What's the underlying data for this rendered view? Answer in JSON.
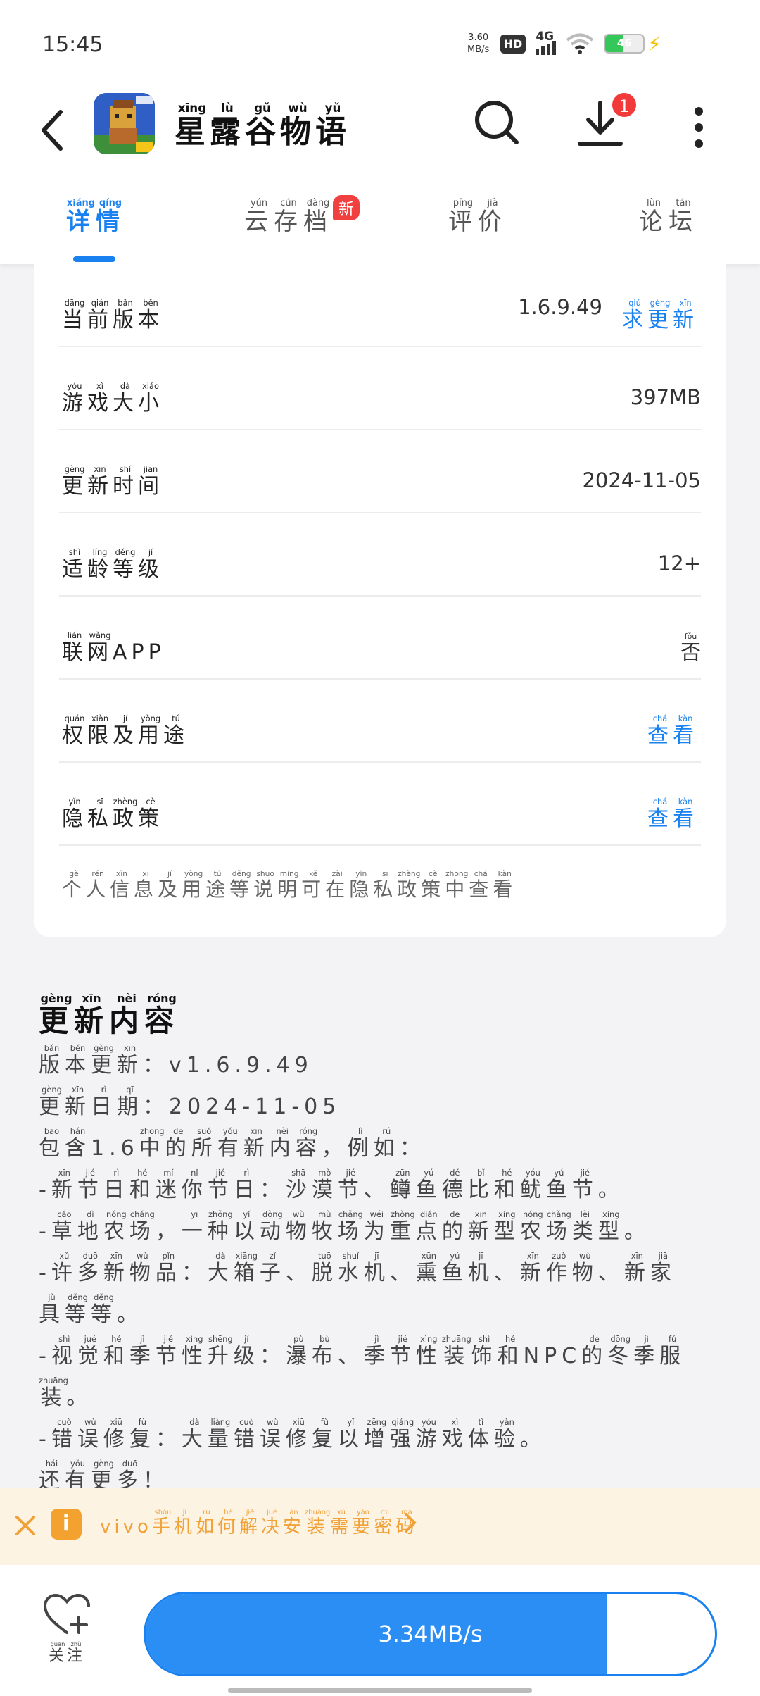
{
  "status_bar": {
    "time": "15:45",
    "net_speed_value": "3.60",
    "net_speed_unit": "MB/s",
    "hd": "HD",
    "network": "4G",
    "battery_level": "46",
    "battery_color": "#35c759"
  },
  "header": {
    "app_title": [
      {
        "char": "星",
        "py": "xīng"
      },
      {
        "char": "露",
        "py": "lù"
      },
      {
        "char": "谷",
        "py": "gǔ"
      },
      {
        "char": "物",
        "py": "wù"
      },
      {
        "char": "语",
        "py": "yǔ"
      }
    ],
    "download_badge": "1",
    "accent_color": "#1a82f0"
  },
  "tabs": {
    "details": [
      {
        "char": "详",
        "py": "xiáng"
      },
      {
        "char": "情",
        "py": "qíng"
      }
    ],
    "cloud_save": [
      {
        "char": "云",
        "py": "yún"
      },
      {
        "char": "存",
        "py": "cún"
      },
      {
        "char": "档",
        "py": "dàng"
      }
    ],
    "cloud_save_badge": "新",
    "reviews": [
      {
        "char": "评",
        "py": "píng"
      },
      {
        "char": "价",
        "py": "jià"
      }
    ],
    "forum": [
      {
        "char": "论",
        "py": "lùn"
      },
      {
        "char": "坛",
        "py": "tán"
      }
    ]
  },
  "info": {
    "current_version_label": [
      {
        "char": "当",
        "py": "dāng"
      },
      {
        "char": "前",
        "py": "qián"
      },
      {
        "char": "版",
        "py": "bǎn"
      },
      {
        "char": "本",
        "py": "běn"
      }
    ],
    "current_version_value": "1.6.9.49",
    "request_update": [
      {
        "char": "求",
        "py": "qiú"
      },
      {
        "char": "更",
        "py": "gèng"
      },
      {
        "char": "新",
        "py": "xīn"
      }
    ],
    "size_label": [
      {
        "char": "游",
        "py": "yóu"
      },
      {
        "char": "戏",
        "py": "xì"
      },
      {
        "char": "大",
        "py": "dà"
      },
      {
        "char": "小",
        "py": "xiǎo"
      }
    ],
    "size_value": "397MB",
    "update_time_label": [
      {
        "char": "更",
        "py": "gèng"
      },
      {
        "char": "新",
        "py": "xīn"
      },
      {
        "char": "时",
        "py": "shí"
      },
      {
        "char": "间",
        "py": "jiān"
      }
    ],
    "update_time_value": "2024-11-05",
    "age_label": [
      {
        "char": "适",
        "py": "shì"
      },
      {
        "char": "龄",
        "py": "líng"
      },
      {
        "char": "等",
        "py": "děng"
      },
      {
        "char": "级",
        "py": "jí"
      }
    ],
    "age_value": "12+",
    "online_label": [
      {
        "char": "联",
        "py": "lián"
      },
      {
        "char": "网",
        "py": "wǎng"
      },
      {
        "char": "APP",
        "py": ""
      }
    ],
    "online_value": [
      {
        "char": "否",
        "py": "fǒu"
      }
    ],
    "permissions_label": [
      {
        "char": "权",
        "py": "quán"
      },
      {
        "char": "限",
        "py": "xiàn"
      },
      {
        "char": "及",
        "py": "jí"
      },
      {
        "char": "用",
        "py": "yòng"
      },
      {
        "char": "途",
        "py": "tú"
      }
    ],
    "privacy_label": [
      {
        "char": "隐",
        "py": "yǐn"
      },
      {
        "char": "私",
        "py": "sī"
      },
      {
        "char": "政",
        "py": "zhèng"
      },
      {
        "char": "策",
        "py": "cè"
      }
    ],
    "view_link": [
      {
        "char": "查",
        "py": "chá"
      },
      {
        "char": "看",
        "py": "kàn"
      }
    ],
    "privacy_note": [
      {
        "char": "个",
        "py": "gè"
      },
      {
        "char": "人",
        "py": "rén"
      },
      {
        "char": "信",
        "py": "xìn"
      },
      {
        "char": "息",
        "py": "xī"
      },
      {
        "char": "及",
        "py": "jí"
      },
      {
        "char": "用",
        "py": "yòng"
      },
      {
        "char": "途",
        "py": "tú"
      },
      {
        "char": "等",
        "py": "děng"
      },
      {
        "char": "说",
        "py": "shuō"
      },
      {
        "char": "明",
        "py": "míng"
      },
      {
        "char": "可",
        "py": "kě"
      },
      {
        "char": "在",
        "py": "zài"
      },
      {
        "char": "隐",
        "py": "yǐn"
      },
      {
        "char": "私",
        "py": "sī"
      },
      {
        "char": "政",
        "py": "zhèng"
      },
      {
        "char": "策",
        "py": "cè"
      },
      {
        "char": "中",
        "py": "zhōng"
      },
      {
        "char": "查",
        "py": "chá"
      },
      {
        "char": "看",
        "py": "kàn"
      }
    ]
  },
  "update": {
    "title": [
      {
        "char": "更",
        "py": "gèng"
      },
      {
        "char": "新",
        "py": "xīn"
      },
      {
        "char": "内",
        "py": "nèi"
      },
      {
        "char": "容",
        "py": "róng"
      }
    ],
    "lines": [
      [
        {
          "char": "版",
          "py": "bǎn"
        },
        {
          "char": "本",
          "py": "běn"
        },
        {
          "char": "更",
          "py": "gèng"
        },
        {
          "char": "新",
          "py": "xīn"
        },
        {
          "char": "：",
          "py": ""
        },
        {
          "char": "v1.6.9.49",
          "py": ""
        }
      ],
      [
        {
          "char": "更",
          "py": "gèng"
        },
        {
          "char": "新",
          "py": "xīn"
        },
        {
          "char": "日",
          "py": "rì"
        },
        {
          "char": "期",
          "py": "qī"
        },
        {
          "char": "：",
          "py": ""
        },
        {
          "char": "2024-11-05",
          "py": ""
        }
      ],
      [
        {
          "char": "包",
          "py": "bāo"
        },
        {
          "char": "含",
          "py": "hán"
        },
        {
          "char": "1.6",
          "py": ""
        },
        {
          "char": "中",
          "py": "zhōng"
        },
        {
          "char": "的",
          "py": "de"
        },
        {
          "char": "所",
          "py": "suǒ"
        },
        {
          "char": "有",
          "py": "yǒu"
        },
        {
          "char": "新",
          "py": "xīn"
        },
        {
          "char": "内",
          "py": "nèi"
        },
        {
          "char": "容",
          "py": "róng"
        },
        {
          "char": "，",
          "py": ""
        },
        {
          "char": "例",
          "py": "lì"
        },
        {
          "char": "如",
          "py": "rú"
        },
        {
          "char": "：",
          "py": ""
        }
      ],
      [
        {
          "char": "-",
          "py": ""
        },
        {
          "char": "新",
          "py": "xīn"
        },
        {
          "char": "节",
          "py": "jié"
        },
        {
          "char": "日",
          "py": "rì"
        },
        {
          "char": "和",
          "py": "hé"
        },
        {
          "char": "迷",
          "py": "mí"
        },
        {
          "char": "你",
          "py": "nǐ"
        },
        {
          "char": "节",
          "py": "jié"
        },
        {
          "char": "日",
          "py": "rì"
        },
        {
          "char": "：",
          "py": ""
        },
        {
          "char": "沙",
          "py": "shā"
        },
        {
          "char": "漠",
          "py": "mò"
        },
        {
          "char": "节",
          "py": "jié"
        },
        {
          "char": "、",
          "py": ""
        },
        {
          "char": "鳟",
          "py": "zūn"
        },
        {
          "char": "鱼",
          "py": "yú"
        },
        {
          "char": "德",
          "py": "dé"
        },
        {
          "char": "比",
          "py": "bǐ"
        },
        {
          "char": "和",
          "py": "hé"
        },
        {
          "char": "鱿",
          "py": "yóu"
        },
        {
          "char": "鱼",
          "py": "yú"
        },
        {
          "char": "节",
          "py": "jié"
        },
        {
          "char": "。",
          "py": ""
        }
      ],
      [
        {
          "char": "-",
          "py": ""
        },
        {
          "char": "草",
          "py": "cǎo"
        },
        {
          "char": "地",
          "py": "dì"
        },
        {
          "char": "农",
          "py": "nóng"
        },
        {
          "char": "场",
          "py": "chǎng"
        },
        {
          "char": "，",
          "py": ""
        },
        {
          "char": "一",
          "py": "yī"
        },
        {
          "char": "种",
          "py": "zhǒng"
        },
        {
          "char": "以",
          "py": "yǐ"
        },
        {
          "char": "动",
          "py": "dòng"
        },
        {
          "char": "物",
          "py": "wù"
        },
        {
          "char": "牧",
          "py": "mù"
        },
        {
          "char": "场",
          "py": "chǎng"
        },
        {
          "char": "为",
          "py": "wéi"
        },
        {
          "char": "重",
          "py": "zhòng"
        },
        {
          "char": "点",
          "py": "diǎn"
        },
        {
          "char": "的",
          "py": "de"
        },
        {
          "char": "新",
          "py": "xīn"
        },
        {
          "char": "型",
          "py": "xíng"
        },
        {
          "char": "农",
          "py": "nóng"
        },
        {
          "char": "场",
          "py": "chǎng"
        },
        {
          "char": "类",
          "py": "lèi"
        },
        {
          "char": "型",
          "py": "xíng"
        },
        {
          "char": "。",
          "py": ""
        }
      ],
      [
        {
          "char": "-",
          "py": ""
        },
        {
          "char": "许",
          "py": "xǔ"
        },
        {
          "char": "多",
          "py": "duō"
        },
        {
          "char": "新",
          "py": "xīn"
        },
        {
          "char": "物",
          "py": "wù"
        },
        {
          "char": "品",
          "py": "pǐn"
        },
        {
          "char": "：",
          "py": ""
        },
        {
          "char": "大",
          "py": "dà"
        },
        {
          "char": "箱",
          "py": "xiāng"
        },
        {
          "char": "子",
          "py": "zǐ"
        },
        {
          "char": "、",
          "py": ""
        },
        {
          "char": "脱",
          "py": "tuō"
        },
        {
          "char": "水",
          "py": "shuǐ"
        },
        {
          "char": "机",
          "py": "jī"
        },
        {
          "char": "、",
          "py": ""
        },
        {
          "char": "熏",
          "py": "xūn"
        },
        {
          "char": "鱼",
          "py": "yú"
        },
        {
          "char": "机",
          "py": "jī"
        },
        {
          "char": "、",
          "py": ""
        },
        {
          "char": "新",
          "py": "xīn"
        },
        {
          "char": "作",
          "py": "zuò"
        },
        {
          "char": "物",
          "py": "wù"
        },
        {
          "char": "、",
          "py": ""
        },
        {
          "char": "新",
          "py": "xīn"
        },
        {
          "char": "家",
          "py": "jiā"
        }
      ],
      [
        {
          "char": "具",
          "py": "jù"
        },
        {
          "char": "等",
          "py": "děng"
        },
        {
          "char": "等",
          "py": "děng"
        },
        {
          "char": "。",
          "py": ""
        }
      ],
      [
        {
          "char": "-",
          "py": ""
        },
        {
          "char": "视",
          "py": "shì"
        },
        {
          "char": "觉",
          "py": "jué"
        },
        {
          "char": "和",
          "py": "hé"
        },
        {
          "char": "季",
          "py": "jì"
        },
        {
          "char": "节",
          "py": "jié"
        },
        {
          "char": "性",
          "py": "xìng"
        },
        {
          "char": "升",
          "py": "shēng"
        },
        {
          "char": "级",
          "py": "jí"
        },
        {
          "char": "：",
          "py": ""
        },
        {
          "char": "瀑",
          "py": "pù"
        },
        {
          "char": "布",
          "py": "bù"
        },
        {
          "char": "、",
          "py": ""
        },
        {
          "char": "季",
          "py": "jì"
        },
        {
          "char": "节",
          "py": "jié"
        },
        {
          "char": "性",
          "py": "xìng"
        },
        {
          "char": "装",
          "py": "zhuāng"
        },
        {
          "char": "饰",
          "py": "shì"
        },
        {
          "char": "和",
          "py": "hé"
        },
        {
          "char": "NPC",
          "py": ""
        },
        {
          "char": "的",
          "py": "de"
        },
        {
          "char": "冬",
          "py": "dōng"
        },
        {
          "char": "季",
          "py": "jì"
        },
        {
          "char": "服",
          "py": "fú"
        }
      ],
      [
        {
          "char": "装",
          "py": "zhuāng"
        },
        {
          "char": "。",
          "py": ""
        }
      ],
      [
        {
          "char": "-",
          "py": ""
        },
        {
          "char": "错",
          "py": "cuò"
        },
        {
          "char": "误",
          "py": "wù"
        },
        {
          "char": "修",
          "py": "xiū"
        },
        {
          "char": "复",
          "py": "fù"
        },
        {
          "char": "：",
          "py": ""
        },
        {
          "char": "大",
          "py": "dà"
        },
        {
          "char": "量",
          "py": "liàng"
        },
        {
          "char": "错",
          "py": "cuò"
        },
        {
          "char": "误",
          "py": "wù"
        },
        {
          "char": "修",
          "py": "xiū"
        },
        {
          "char": "复",
          "py": "fù"
        },
        {
          "char": "以",
          "py": "yǐ"
        },
        {
          "char": "增",
          "py": "zēng"
        },
        {
          "char": "强",
          "py": "qiáng"
        },
        {
          "char": "游",
          "py": "yóu"
        },
        {
          "char": "戏",
          "py": "xì"
        },
        {
          "char": "体",
          "py": "tǐ"
        },
        {
          "char": "验",
          "py": "yàn"
        },
        {
          "char": "。",
          "py": ""
        }
      ],
      [
        {
          "char": "还",
          "py": "hái"
        },
        {
          "char": "有",
          "py": "yǒu"
        },
        {
          "char": "更",
          "py": "gèng"
        },
        {
          "char": "多",
          "py": "duō"
        },
        {
          "char": "！",
          "py": ""
        }
      ]
    ]
  },
  "tip": {
    "text": [
      {
        "char": "vivo",
        "py": ""
      },
      {
        "char": "手",
        "py": "shǒu"
      },
      {
        "char": "机",
        "py": "jī"
      },
      {
        "char": "如",
        "py": "rú"
      },
      {
        "char": "何",
        "py": "hé"
      },
      {
        "char": "解",
        "py": "jiě"
      },
      {
        "char": "决",
        "py": "jué"
      },
      {
        "char": "安",
        "py": "ān"
      },
      {
        "char": "装",
        "py": "zhuāng"
      },
      {
        "char": "需",
        "py": "xū"
      },
      {
        "char": "要",
        "py": "yào"
      },
      {
        "char": "密",
        "py": "mì"
      },
      {
        "char": "码",
        "py": "mǎ"
      }
    ],
    "icon_glyph": "i",
    "color": "#f0a138"
  },
  "bottom": {
    "follow_label": [
      {
        "char": "关",
        "py": "guān"
      },
      {
        "char": "注",
        "py": "zhù"
      }
    ],
    "download_speed": "3.34MB/s",
    "download_progress": 0.81
  }
}
